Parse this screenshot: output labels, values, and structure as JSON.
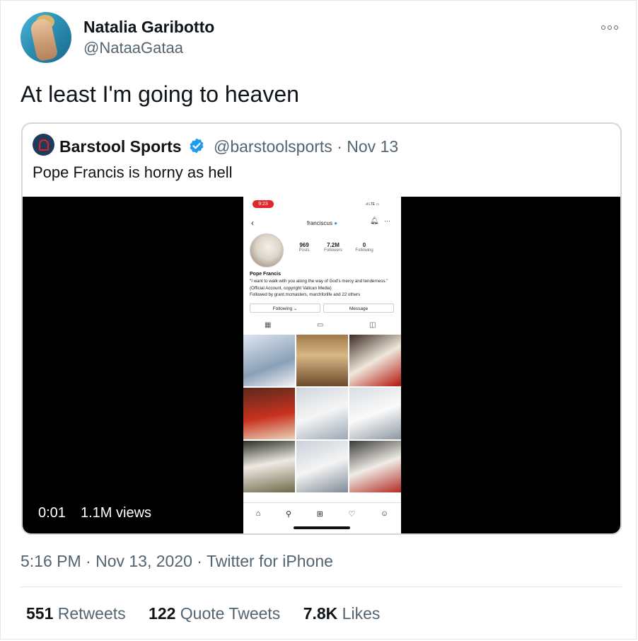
{
  "author": {
    "name": "Natalia Garibotto",
    "handle": "@NataaGataa"
  },
  "tweet_text": "At least I'm going to heaven",
  "quoted": {
    "name": "Barstool Sports",
    "handle": "@barstoolsports",
    "date": "Nov 13",
    "text": "Pope Francis is horny as hell",
    "video": {
      "elapsed": "0:01",
      "views": "1.1M views",
      "phone": {
        "status_time": "9:23",
        "status_right": ".ıl LTE ▭",
        "username": "franciscus",
        "stats": [
          {
            "number": "969",
            "label": "Posts"
          },
          {
            "number": "7.2M",
            "label": "Followers"
          },
          {
            "number": "0",
            "label": "Following"
          }
        ],
        "bio_name": "Pope Francis",
        "bio_text": "\"I want to walk with you along the way of God's mercy and tenderness.\" (Official Account, copyright Vatican Media)",
        "followed_by": "Followed by grant.mcmasters, marchforlife and 22 others",
        "following_button": "Following ⌄",
        "message_button": "Message"
      }
    }
  },
  "timestamp": "5:16 PM · Nov 13, 2020 · Twitter for iPhone",
  "engagement": {
    "retweets": {
      "count": "551",
      "label": "Retweets"
    },
    "quote_tweets": {
      "count": "122",
      "label": "Quote Tweets"
    },
    "likes": {
      "count": "7.8K",
      "label": "Likes"
    }
  },
  "colors": {
    "verified_blue": "#1d9bf0",
    "secondary_text": "#536471",
    "border": "#cfd9de"
  }
}
